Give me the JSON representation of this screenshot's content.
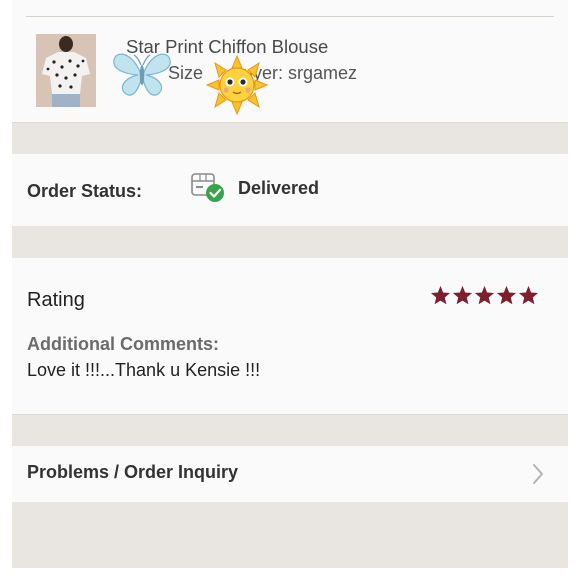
{
  "item": {
    "title": "Star Print Chiffon Blouse",
    "size_label": "Size",
    "buyer_label": "Buyer: srgamez"
  },
  "order_status": {
    "label": "Order Status:",
    "value": "Delivered",
    "icon": "package-delivered-icon"
  },
  "rating": {
    "label": "Rating",
    "stars": 5,
    "max_stars": 5,
    "star_color": "#7d1f2c",
    "comments_label": "Additional Comments:",
    "comments_text": "Love it !!!...Thank u Kensie !!!"
  },
  "inquiry": {
    "label": "Problems / Order Inquiry"
  },
  "stickers": [
    "butterfly",
    "sun"
  ]
}
